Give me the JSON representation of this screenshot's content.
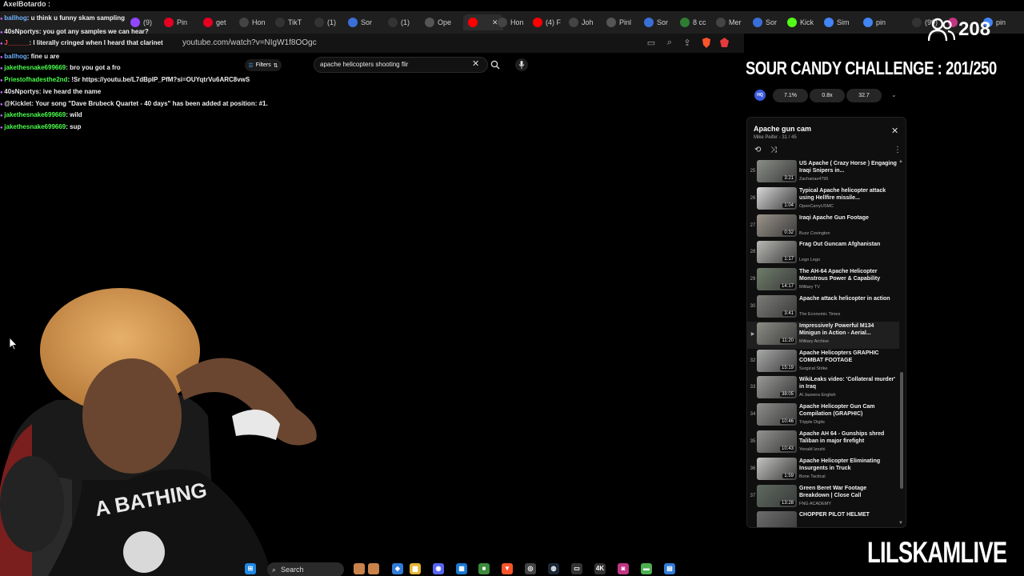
{
  "overlay": {
    "streamer_user": "AxelBotardo :",
    "challenge": "SOUR CANDY CHALLENGE : 201/250",
    "viewer_count": "208",
    "brand": "LILSKAMLIVE"
  },
  "browser": {
    "url": "youtube.com/watch?v=NIgW1f8OOgc",
    "tabs": [
      {
        "label": "(9)",
        "icon": "twitch",
        "color": "#9146ff"
      },
      {
        "label": "Pin",
        "icon": "pinterest",
        "color": "#e60023"
      },
      {
        "label": "get",
        "icon": "pinterest",
        "color": "#e60023"
      },
      {
        "label": "Hon",
        "icon": "x",
        "color": "#444"
      },
      {
        "label": "TikT",
        "icon": "tiktok",
        "color": "#333"
      },
      {
        "label": "(1)",
        "icon": "tiktok",
        "color": "#333"
      },
      {
        "label": "Sor",
        "icon": "soundcloud",
        "color": "#3a6fd8"
      },
      {
        "label": "(1)",
        "icon": "tiktok",
        "color": "#333"
      },
      {
        "label": "Ope",
        "icon": "openai",
        "color": "#555"
      },
      {
        "label": "",
        "icon": "youtube",
        "color": "#ff0000"
      },
      {
        "label": "Hon",
        "icon": "x",
        "color": "#444"
      },
      {
        "label": "(4) F",
        "icon": "youtube",
        "color": "#ff0000"
      },
      {
        "label": "Joh",
        "icon": "x",
        "color": "#444"
      },
      {
        "label": "Pinl",
        "icon": "openai",
        "color": "#555"
      },
      {
        "label": "Sor",
        "icon": "soundcloud",
        "color": "#3a6fd8"
      },
      {
        "label": "8 cc",
        "icon": "chrome",
        "color": "#2e7d32"
      },
      {
        "label": "Mer",
        "icon": "b",
        "color": "#444"
      },
      {
        "label": "Sor",
        "icon": "soundcloud",
        "color": "#3a6fd8"
      },
      {
        "label": "Kick",
        "icon": "kick",
        "color": "#53fc18"
      },
      {
        "label": "Sim",
        "icon": "google",
        "color": "#4285f4"
      },
      {
        "label": "pin",
        "icon": "google",
        "color": "#4285f4"
      },
      {
        "label": "(99)",
        "icon": "tiktok",
        "color": "#333"
      },
      {
        "label": "",
        "icon": "instagram",
        "color": "#c13584"
      },
      {
        "label": "pin",
        "icon": "google",
        "color": "#4285f4"
      }
    ]
  },
  "chat": [
    {
      "name": "ballhog",
      "msg": ": u think u funny skam sampling",
      "color": "#6fb3ff"
    },
    {
      "name": "40sNportys",
      "msg": ": you got any samples we can hear?",
      "color": "#e8e8e8"
    },
    {
      "name": "J______",
      "msg": ": I literally cringed when I heard that clarinet",
      "color": "#ff4a4a"
    },
    {
      "name": "ballhog",
      "msg": ": fine u are",
      "color": "#6fb3ff"
    },
    {
      "name": "jakethesnake699669",
      "msg": ": bro you got a fro",
      "color": "#4cff4c"
    },
    {
      "name": "Priestofhadesthe2nd",
      "msg": ": !Sr https://youtu.be/L7dBpIP_PfM?si=OUYqtrVu6ARC8vwS",
      "color": "#4cff4c"
    },
    {
      "name": "40sNportys",
      "msg": ": ive heard the name",
      "color": "#e8e8e8"
    },
    {
      "name": "@Kicklet",
      "msg": ": Your song \"Dave Brubeck Quartet - 40 days\" has been added at position: #1.",
      "color": "#e8e8e8"
    },
    {
      "name": "jakethesnake699669",
      "msg": ": wild",
      "color": "#4cff4c"
    },
    {
      "name": "jakethesnake699669",
      "msg": ": sup",
      "color": "#4cff4c"
    }
  ],
  "search": {
    "query": "apache helicopters shooting flir",
    "filters_label": "Filters"
  },
  "stats": [
    "7.1%",
    "0.8x",
    "32.7"
  ],
  "playlist": {
    "title": "Apache gun cam",
    "subtitle": "Mike Peifer - 31 / 45",
    "items": [
      {
        "num": "25",
        "title": "US Apache ( Crazy Horse ) Engaging Iraqi Snipers in...",
        "channel": "Zacharias4795",
        "duration": "3:21",
        "thumb": "#8a8f88"
      },
      {
        "num": "26",
        "title": "Typical Apache helicopter attack using Hellfire missile...",
        "channel": "OpenCarryUSMC",
        "duration": "1:04",
        "thumb": "#d8d8d8"
      },
      {
        "num": "27",
        "title": "Iraqi Apache Gun Footage",
        "channel": "Buzz Covington",
        "duration": "0:32",
        "thumb": "#9a948a"
      },
      {
        "num": "28",
        "title": "Frag Out Guncam Afghanistan",
        "channel": "Lego Lego",
        "duration": "1:17",
        "thumb": "#b9b9b5"
      },
      {
        "num": "29",
        "title": "The AH-64 Apache Helicopter Monstrous Power & Capability",
        "channel": "Military TV",
        "duration": "14:17",
        "thumb": "#6f7d6a"
      },
      {
        "num": "30",
        "title": "Apache attack helicopter in action",
        "channel": "The Economic Times",
        "duration": "3:41",
        "thumb": "#7b7b78"
      },
      {
        "num": "",
        "title": "Impressively Powerful M134 Minigun in Action - Aerial...",
        "channel": "Military Archive",
        "duration": "11:20",
        "thumb": "#8d8d86",
        "active": true
      },
      {
        "num": "32",
        "title": "Apache Helicopters GRAPHIC COMBAT FOOTAGE",
        "channel": "Surgical Strike",
        "duration": "15:19",
        "thumb": "#a8aaa8"
      },
      {
        "num": "33",
        "title": "WikiLeaks video: 'Collateral murder' in Iraq",
        "channel": "Al Jazeera English",
        "duration": "38:05",
        "thumb": "#9a9a98"
      },
      {
        "num": "34",
        "title": "Apache Helicopter Gun Cam Compilation (GRAPHIC)",
        "channel": "Tripple Digits",
        "duration": "10:46",
        "thumb": "#8e8e8c"
      },
      {
        "num": "35",
        "title": "Apache AH 64 - Gunships shred Taliban in major firefight",
        "channel": "Yenald Izoshi",
        "duration": "10:43",
        "thumb": "#939390"
      },
      {
        "num": "36",
        "title": "Apache Helicopter Eliminating Insurgents in Truck",
        "channel": "Bone Tactical",
        "duration": "1:59",
        "thumb": "#c4c4c2"
      },
      {
        "num": "37",
        "title": "Green Beret War Footage Breakdown | Close Call",
        "channel": "FNG ACADEMY",
        "duration": "13:28",
        "thumb": "#5e6a60"
      },
      {
        "num": "",
        "title": "CHOPPER PILOT HELMET",
        "channel": "",
        "duration": "",
        "thumb": "#6d6d6d"
      }
    ]
  },
  "taskbar": {
    "search_label": "Search"
  }
}
